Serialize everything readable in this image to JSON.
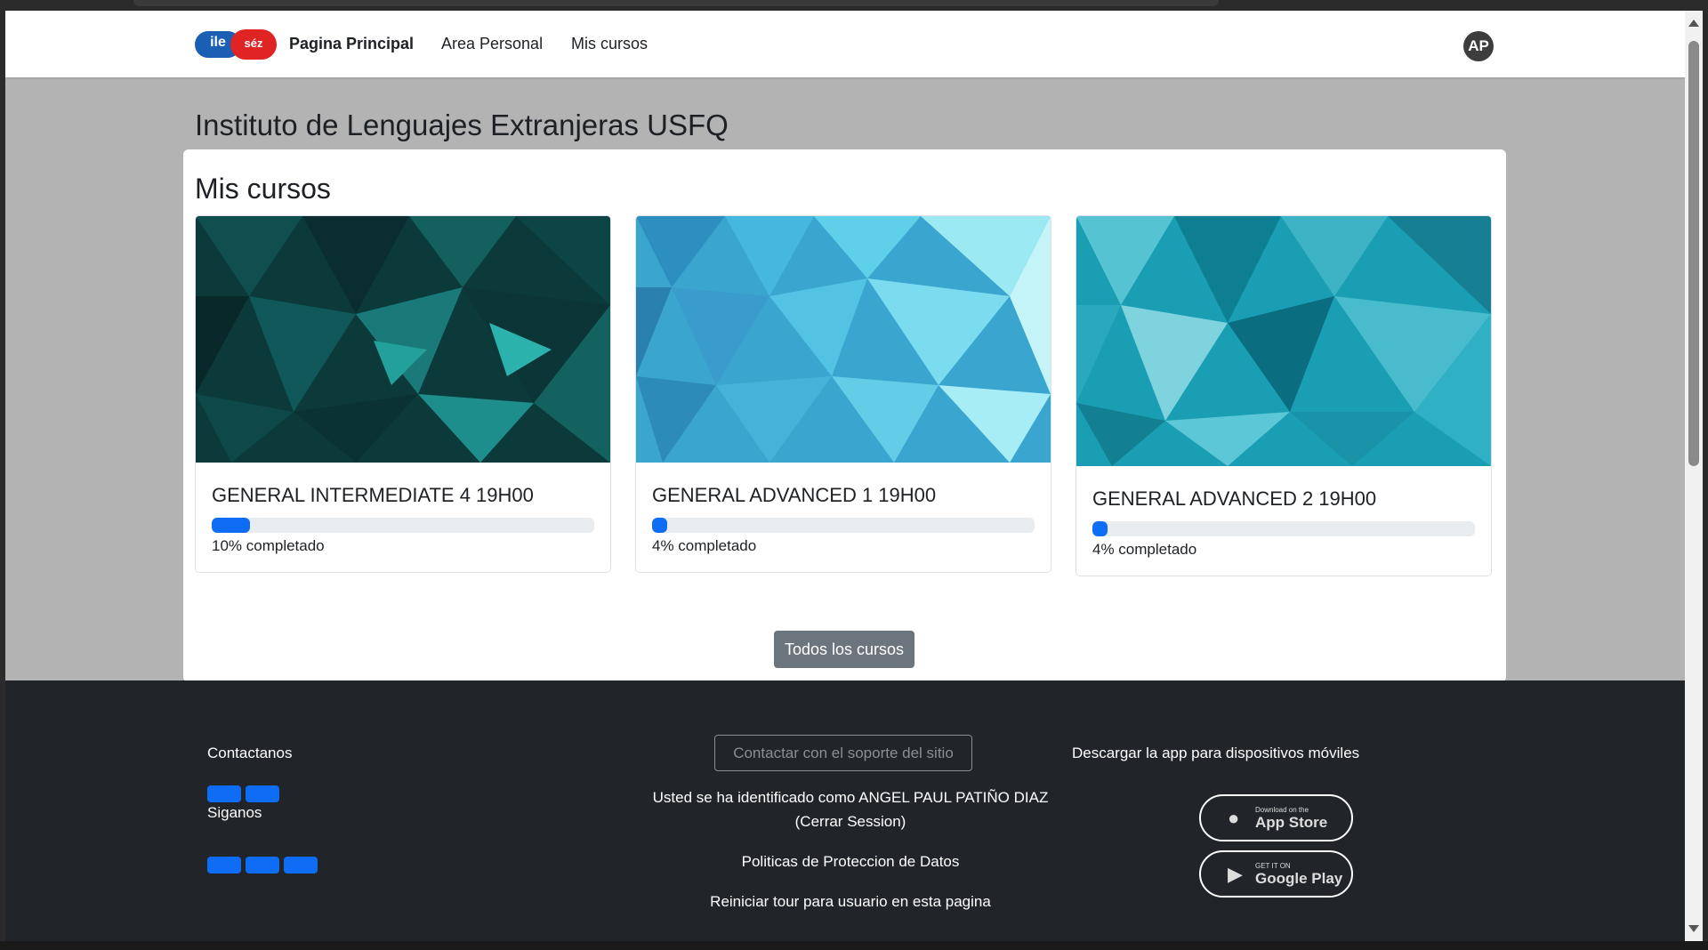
{
  "navbar": {
    "logo_left": "ile",
    "logo_right": "séz",
    "brand": "Pagina Principal",
    "link_area": "Area Personal",
    "link_cursos": "Mis cursos",
    "avatar_initials": "AP"
  },
  "site_title": "Instituto de Lenguajes Extranjeras USFQ",
  "panel": {
    "title": "Mis cursos",
    "courses": [
      {
        "name": "GENERAL INTERMEDIATE 4 19H00",
        "progress": 10,
        "progress_text": "10% completado"
      },
      {
        "name": "GENERAL ADVANCED 1 19H00",
        "progress": 4,
        "progress_text": "4% completado"
      },
      {
        "name": "GENERAL ADVANCED 2 19H00",
        "progress": 4,
        "progress_text": "4% completado"
      }
    ],
    "all_courses_button": "Todos los cursos"
  },
  "footer": {
    "contact": "Contactanos",
    "follow": "Siganos",
    "support_button": "Contactar con el soporte del sitio",
    "logged_in": "Usted se ha identificado como ANGEL PAUL PATIÑO DIAZ",
    "logout": "(Cerrar Session)",
    "privacy": "Politicas de Proteccion de Datos",
    "tour": "Reiniciar tour para usuario en esta pagina",
    "app_download": "Descargar la app para dispositivos móviles",
    "app_store_small": "Download on the",
    "app_store_big": "App Store",
    "google_play_small": "GET IT ON",
    "google_play_big": "Google Play"
  },
  "colors": {
    "accent": "#0f6cf5",
    "footer_bg": "#212529",
    "page_bg": "#b3b3b3"
  }
}
